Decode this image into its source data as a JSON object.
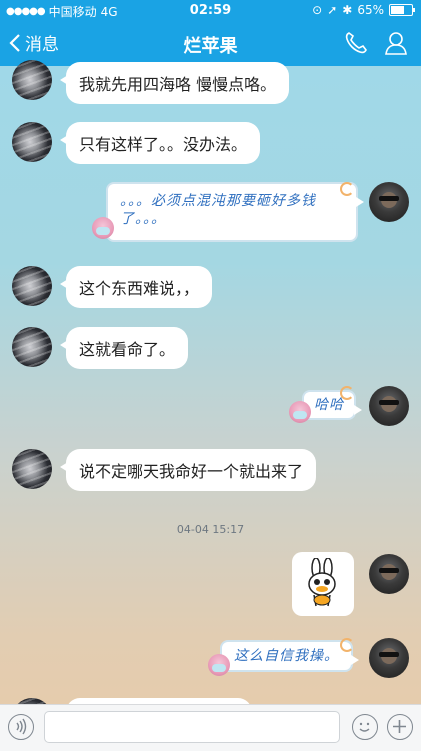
{
  "status_bar": {
    "carrier": "中国移动",
    "network": "4G",
    "time": "02:59",
    "battery": "65%",
    "battery_level": 0.65
  },
  "nav": {
    "back_label": "消息",
    "title": "烂苹果"
  },
  "messages": [
    {
      "side": "in",
      "text": "我就先用四海咯  慢慢点咯。"
    },
    {
      "side": "in",
      "text": "只有这样了。。没办法。"
    },
    {
      "side": "out",
      "text": "。。。必须点混沌那要砸好多钱了。。。"
    },
    {
      "side": "in",
      "text": "这个东西难说，，"
    },
    {
      "side": "in",
      "text": "这就看命了。"
    },
    {
      "side": "out",
      "text": "哈哈"
    },
    {
      "side": "in",
      "text": "说不定哪天我命好一个就出来了"
    },
    {
      "side": "out",
      "text": "这么自信我操。"
    }
  ],
  "timestamp": "04-04 15:17",
  "colors": {
    "nav_bg": "#1aa3e4",
    "script_text": "#2f6fbf"
  }
}
